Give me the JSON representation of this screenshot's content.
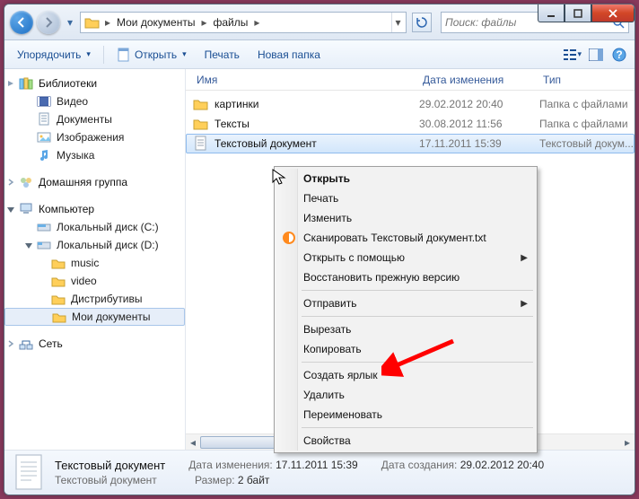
{
  "breadcrumb": {
    "items": [
      "Мои документы",
      "файлы"
    ]
  },
  "search": {
    "placeholder": "Поиск: файлы"
  },
  "toolbar": {
    "organize": "Упорядочить",
    "open": "Открыть",
    "print": "Печать",
    "newfolder": "Новая папка"
  },
  "nav": {
    "libraries": "Библиотеки",
    "video": "Видео",
    "documents": "Документы",
    "images": "Изображения",
    "music": "Музыка",
    "homegroup": "Домашняя группа",
    "computer": "Компьютер",
    "driveC": "Локальный диск (C:)",
    "driveD": "Локальный диск (D:)",
    "music2": "music",
    "video2": "video",
    "distr": "Дистрибутивы",
    "mydocs": "Мои документы",
    "network": "Сеть"
  },
  "columns": {
    "name": "Имя",
    "date": "Дата изменения",
    "type": "Тип"
  },
  "files": [
    {
      "name": "картинки",
      "date": "29.02.2012 20:40",
      "type": "Папка с файлами",
      "kind": "folder"
    },
    {
      "name": "Тексты",
      "date": "30.08.2012 11:56",
      "type": "Папка с файлами",
      "kind": "folder"
    },
    {
      "name": "Текстовый документ",
      "date": "17.11.2011 15:39",
      "type": "Текстовый докум...",
      "kind": "txt"
    }
  ],
  "ctx": {
    "open": "Открыть",
    "print": "Печать",
    "edit": "Изменить",
    "scan": "Сканировать Текстовый документ.txt",
    "openwith": "Открыть с помощью",
    "restore": "Восстановить прежную версию",
    "sendto": "Отправить",
    "cut": "Вырезать",
    "copy": "Копировать",
    "shortcut": "Создать ярлык",
    "delete": "Удалить",
    "rename": "Переименовать",
    "properties": "Свойства"
  },
  "status": {
    "title": "Текстовый документ",
    "subtitle": "Текстовый документ",
    "modified_k": "Дата изменения:",
    "modified_v": "17.11.2011 15:39",
    "size_k": "Размер:",
    "size_v": "2 байт",
    "created_k": "Дата создания:",
    "created_v": "29.02.2012 20:40"
  }
}
